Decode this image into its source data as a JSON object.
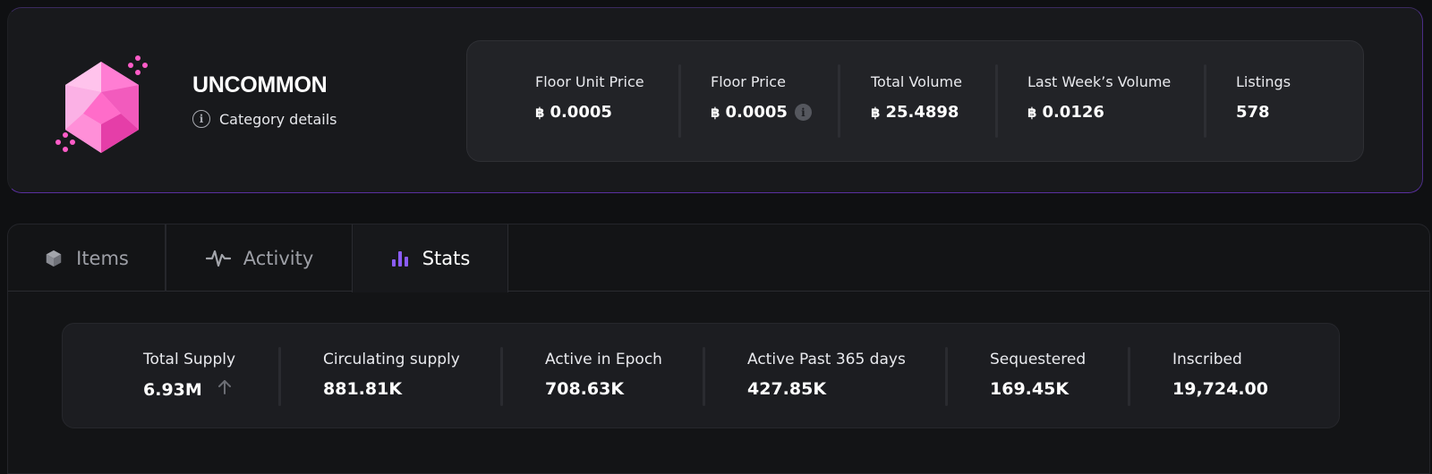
{
  "header": {
    "title": "UNCOMMON",
    "category_details": "Category details",
    "icon": "pink-gem-icon",
    "accent_color": "#ff5cc8"
  },
  "market_stats": [
    {
      "label": "Floor Unit Price",
      "currency": "฿",
      "value": "0.0005"
    },
    {
      "label": "Floor Price",
      "currency": "฿",
      "value": "0.0005",
      "info": "i"
    },
    {
      "label": "Total Volume",
      "currency": "฿",
      "value": "25.4898"
    },
    {
      "label": "Last Week’s Volume",
      "currency": "฿",
      "value": "0.0126"
    },
    {
      "label": "Listings",
      "value": "578"
    }
  ],
  "tabs": [
    {
      "label": "Items",
      "icon": "cube-icon",
      "active": false
    },
    {
      "label": "Activity",
      "icon": "pulse-icon",
      "active": false
    },
    {
      "label": "Stats",
      "icon": "bar-chart-icon",
      "active": true
    }
  ],
  "supply_stats": [
    {
      "label": "Total Supply",
      "value": "6.93M",
      "trend_icon": "arrow-up-icon"
    },
    {
      "label": "Circulating supply",
      "value": "881.81K"
    },
    {
      "label": "Active in Epoch",
      "value": "708.63K"
    },
    {
      "label": "Active Past 365 days",
      "value": "427.85K"
    },
    {
      "label": "Sequestered",
      "value": "169.45K"
    },
    {
      "label": "Inscribed",
      "value": "19,724.00"
    }
  ],
  "colors": {
    "active_tab_icon": "#8b5cf6",
    "border_glow": "#5a2fa0"
  }
}
